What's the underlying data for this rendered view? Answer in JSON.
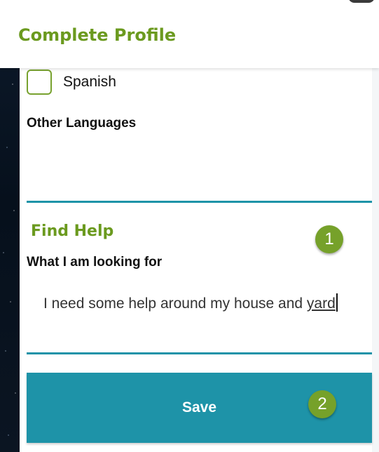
{
  "header": {
    "title": "Complete Profile"
  },
  "languages": {
    "option_spanish": {
      "label": "Spanish",
      "checked": false
    },
    "other_label": "Other Languages",
    "other_value": ""
  },
  "find_help": {
    "title": "Find Help",
    "looking_label": "What I am looking for",
    "looking_value_part1": "I need some help around my house and ",
    "looking_value_part2": "yard"
  },
  "actions": {
    "save_label": "Save"
  },
  "callouts": {
    "badge_1": "1",
    "badge_2": "2"
  },
  "colors": {
    "brand_green": "#6b9a1f",
    "accent_teal": "#1e93a8",
    "badge_green": "#76a12a"
  }
}
